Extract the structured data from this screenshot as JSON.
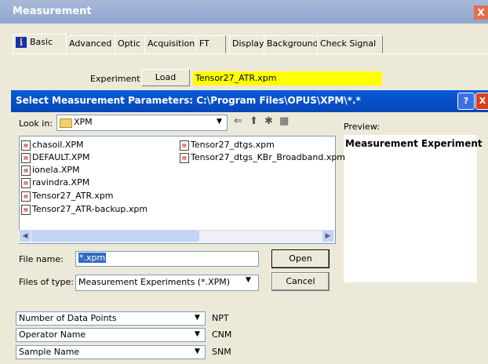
{
  "background_window": {
    "title": "Measurement",
    "close_glyph": "X",
    "tabs": [
      "Basic",
      "Advanced",
      "Optic",
      "Acquisition",
      "FT",
      "Display",
      "Background",
      "Check Signal"
    ],
    "experiment_label": "Experiment:",
    "load_label": "Load",
    "experiment_value": "Tensor27_ATR.xpm"
  },
  "dialog": {
    "title": "Select Measurement Parameters: C:\\Program Files\\OPUS\\XPM\\*.*",
    "help_glyph": "?",
    "close_glyph": "X",
    "look_in_label": "Look in:",
    "look_in_value": "XPM",
    "preview_label": "Preview:",
    "preview_text": "Measurement Experiment",
    "files_col1": [
      "chasoil.XPM",
      "DEFAULT.XPM",
      "ionela.XPM",
      "ravindra.XPM",
      "Tensor27_ATR.xpm",
      "Tensor27_ATR-backup.xpm"
    ],
    "files_col2": [
      "Tensor27_dtgs.xpm",
      "Tensor27_dtgs_KBr_Broadband.xpm"
    ],
    "file_name_label": "File name:",
    "file_name_value": "*.xpm",
    "files_of_type_label": "Files of type:",
    "files_of_type_value": "Measurement Experiments (*.XPM)",
    "open_label": "Open",
    "cancel_label": "Cancel"
  },
  "params": [
    {
      "name": "Number of Data Points",
      "code": "NPT"
    },
    {
      "name": "Operator Name",
      "code": "CNM"
    },
    {
      "name": "Sample Name",
      "code": "SNM"
    }
  ],
  "colors": {
    "title_bar": "#0a5ad8",
    "experiment_highlight": "#ffff00"
  }
}
